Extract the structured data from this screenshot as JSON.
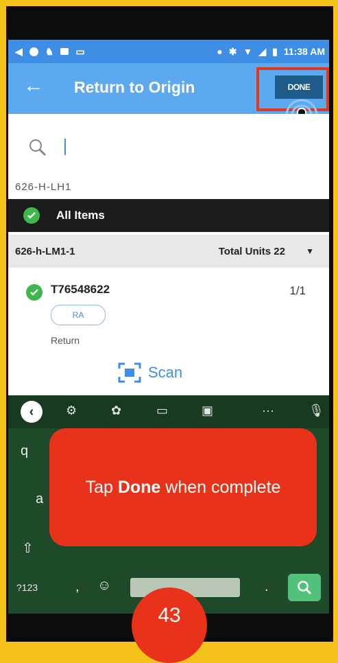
{
  "statusbar": {
    "time": "11:38 AM"
  },
  "appbar": {
    "back_icon": "arrow-left-icon",
    "title": "Return to Origin",
    "done_label": "DONE"
  },
  "search": {
    "icon": "search-icon",
    "value": ""
  },
  "location": {
    "label": "626-H-LH1"
  },
  "all_items": {
    "label": "All Items"
  },
  "group": {
    "name": "626-h-LM1-1",
    "units": "Total Units 22"
  },
  "item": {
    "id": "T76548622",
    "count": "1/1",
    "tag": "RA",
    "type": "Return"
  },
  "scan": {
    "label": "Scan"
  },
  "keyboard": {
    "row1_first": "q",
    "row2_first": "a",
    "numbers_key": "?123",
    "comma": ",",
    "period": "."
  },
  "tooltip": {
    "prefix": "Tap ",
    "bold": "Done",
    "suffix": " when complete"
  },
  "page_number": "43",
  "colors": {
    "accent": "#3e8ee3",
    "appbar": "#5ca9ef",
    "highlight": "#e9321a",
    "success": "#3fb64e",
    "frame": "#f4c21a"
  }
}
